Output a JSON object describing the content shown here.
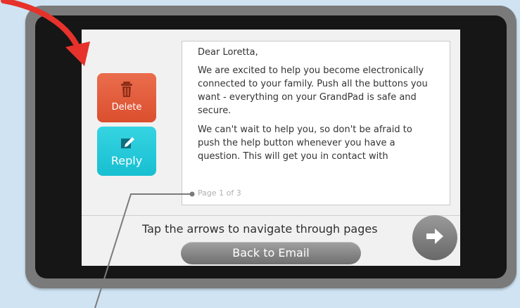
{
  "page": {
    "background": "#cfe3f3",
    "frame_color": "#7a7a7a",
    "screen_color": "#f1f1f1",
    "callout_color": "#e6322b",
    "leader_color": "#7b7b7b"
  },
  "sidebar": {
    "delete": {
      "label": "Delete",
      "icon": "trash-icon",
      "color": "#df5a39"
    },
    "reply": {
      "label": "Reply",
      "icon": "compose-icon",
      "color": "#1bc5d6"
    }
  },
  "message": {
    "salutation": "Dear Loretta,",
    "paragraphs": [
      "We are excited to help you become electronically connected to your family. Push all the buttons you want - everything on your GrandPad is safe and secure.",
      "We can't wait to help you, so don't be afraid to push the help button whenever you have a question. This will get you in contact with"
    ],
    "page_indicator": "Page 1 of 3"
  },
  "footer": {
    "hint": "Tap the arrows to navigate through pages",
    "back_button_label": "Back to Email",
    "next_arrow_icon": "arrow-right-icon"
  }
}
